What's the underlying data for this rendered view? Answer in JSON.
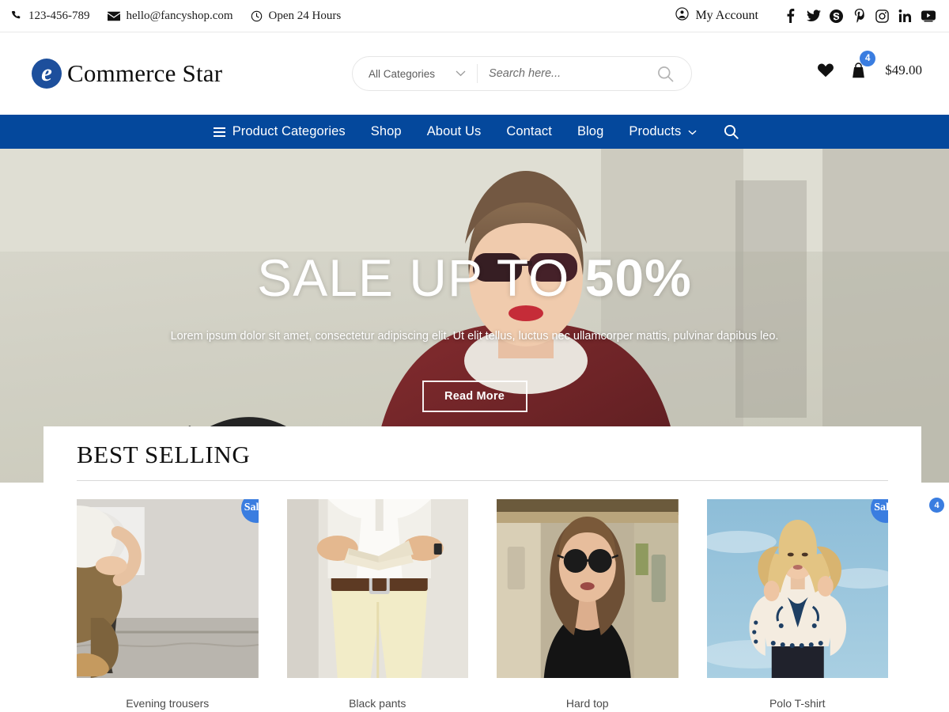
{
  "topbar": {
    "phone": "123-456-789",
    "email": "hello@fancyshop.com",
    "hours": "Open 24 Hours",
    "account_label": "My Account",
    "socials": [
      {
        "name": "facebook-icon",
        "label": "Facebook"
      },
      {
        "name": "twitter-icon",
        "label": "Twitter"
      },
      {
        "name": "skype-icon",
        "label": "Skype"
      },
      {
        "name": "pinterest-icon",
        "label": "Pinterest"
      },
      {
        "name": "instagram-icon",
        "label": "Instagram"
      },
      {
        "name": "linkedin-icon",
        "label": "LinkedIn"
      },
      {
        "name": "youtube-icon",
        "label": "YouTube"
      }
    ]
  },
  "header": {
    "logo_mark": "e",
    "logo_text": "Commerce Star",
    "search": {
      "category_label": "All Categories",
      "placeholder": "Search here...",
      "value": ""
    },
    "cart": {
      "count": "4",
      "total": "$49.00"
    }
  },
  "nav": {
    "items": [
      {
        "label": "Product Categories",
        "has_burger": true,
        "has_chevron": false
      },
      {
        "label": "Shop",
        "has_burger": false,
        "has_chevron": false
      },
      {
        "label": "About Us",
        "has_burger": false,
        "has_chevron": false
      },
      {
        "label": "Contact",
        "has_burger": false,
        "has_chevron": false
      },
      {
        "label": "Blog",
        "has_burger": false,
        "has_chevron": false
      },
      {
        "label": "Products",
        "has_burger": false,
        "has_chevron": true
      }
    ],
    "bg_color": "#04489c"
  },
  "hero": {
    "title_light": "SALE UP TO ",
    "title_bold": "50%",
    "subtitle": "Lorem ipsum dolor sit amet, consectetur adipiscing elit. Ut elit tellus, luctus nec ullamcorper mattis, pulvinar dapibus leo.",
    "button_label": "Read More"
  },
  "section": {
    "title": "BEST SELLING"
  },
  "products": [
    {
      "name": "Evening trousers",
      "sale": true,
      "sale_label": "Sale!"
    },
    {
      "name": "Black pants",
      "sale": false,
      "sale_label": ""
    },
    {
      "name": "Hard top",
      "sale": false,
      "sale_label": ""
    },
    {
      "name": "Polo T-shirt",
      "sale": true,
      "sale_label": "Sale!"
    }
  ],
  "floating": {
    "cart_count": "4"
  },
  "colors": {
    "nav_blue": "#04489c",
    "badge_blue": "#3a7de0",
    "logo_blue": "#1d4f9c"
  }
}
